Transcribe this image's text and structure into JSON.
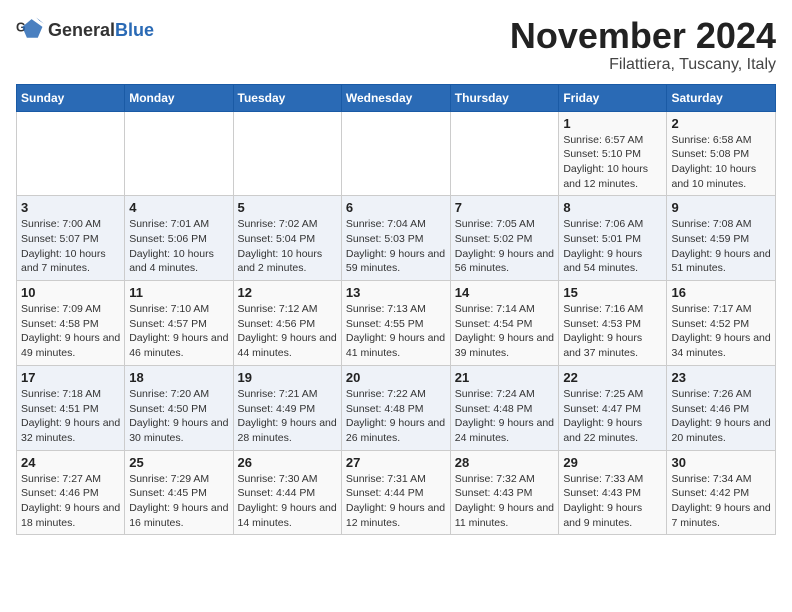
{
  "logo": {
    "general": "General",
    "blue": "Blue"
  },
  "header": {
    "month": "November 2024",
    "location": "Filattiera, Tuscany, Italy"
  },
  "weekdays": [
    "Sunday",
    "Monday",
    "Tuesday",
    "Wednesday",
    "Thursday",
    "Friday",
    "Saturday"
  ],
  "weeks": [
    [
      {
        "day": "",
        "info": ""
      },
      {
        "day": "",
        "info": ""
      },
      {
        "day": "",
        "info": ""
      },
      {
        "day": "",
        "info": ""
      },
      {
        "day": "",
        "info": ""
      },
      {
        "day": "1",
        "info": "Sunrise: 6:57 AM\nSunset: 5:10 PM\nDaylight: 10 hours and 12 minutes."
      },
      {
        "day": "2",
        "info": "Sunrise: 6:58 AM\nSunset: 5:08 PM\nDaylight: 10 hours and 10 minutes."
      }
    ],
    [
      {
        "day": "3",
        "info": "Sunrise: 7:00 AM\nSunset: 5:07 PM\nDaylight: 10 hours and 7 minutes."
      },
      {
        "day": "4",
        "info": "Sunrise: 7:01 AM\nSunset: 5:06 PM\nDaylight: 10 hours and 4 minutes."
      },
      {
        "day": "5",
        "info": "Sunrise: 7:02 AM\nSunset: 5:04 PM\nDaylight: 10 hours and 2 minutes."
      },
      {
        "day": "6",
        "info": "Sunrise: 7:04 AM\nSunset: 5:03 PM\nDaylight: 9 hours and 59 minutes."
      },
      {
        "day": "7",
        "info": "Sunrise: 7:05 AM\nSunset: 5:02 PM\nDaylight: 9 hours and 56 minutes."
      },
      {
        "day": "8",
        "info": "Sunrise: 7:06 AM\nSunset: 5:01 PM\nDaylight: 9 hours and 54 minutes."
      },
      {
        "day": "9",
        "info": "Sunrise: 7:08 AM\nSunset: 4:59 PM\nDaylight: 9 hours and 51 minutes."
      }
    ],
    [
      {
        "day": "10",
        "info": "Sunrise: 7:09 AM\nSunset: 4:58 PM\nDaylight: 9 hours and 49 minutes."
      },
      {
        "day": "11",
        "info": "Sunrise: 7:10 AM\nSunset: 4:57 PM\nDaylight: 9 hours and 46 minutes."
      },
      {
        "day": "12",
        "info": "Sunrise: 7:12 AM\nSunset: 4:56 PM\nDaylight: 9 hours and 44 minutes."
      },
      {
        "day": "13",
        "info": "Sunrise: 7:13 AM\nSunset: 4:55 PM\nDaylight: 9 hours and 41 minutes."
      },
      {
        "day": "14",
        "info": "Sunrise: 7:14 AM\nSunset: 4:54 PM\nDaylight: 9 hours and 39 minutes."
      },
      {
        "day": "15",
        "info": "Sunrise: 7:16 AM\nSunset: 4:53 PM\nDaylight: 9 hours and 37 minutes."
      },
      {
        "day": "16",
        "info": "Sunrise: 7:17 AM\nSunset: 4:52 PM\nDaylight: 9 hours and 34 minutes."
      }
    ],
    [
      {
        "day": "17",
        "info": "Sunrise: 7:18 AM\nSunset: 4:51 PM\nDaylight: 9 hours and 32 minutes."
      },
      {
        "day": "18",
        "info": "Sunrise: 7:20 AM\nSunset: 4:50 PM\nDaylight: 9 hours and 30 minutes."
      },
      {
        "day": "19",
        "info": "Sunrise: 7:21 AM\nSunset: 4:49 PM\nDaylight: 9 hours and 28 minutes."
      },
      {
        "day": "20",
        "info": "Sunrise: 7:22 AM\nSunset: 4:48 PM\nDaylight: 9 hours and 26 minutes."
      },
      {
        "day": "21",
        "info": "Sunrise: 7:24 AM\nSunset: 4:48 PM\nDaylight: 9 hours and 24 minutes."
      },
      {
        "day": "22",
        "info": "Sunrise: 7:25 AM\nSunset: 4:47 PM\nDaylight: 9 hours and 22 minutes."
      },
      {
        "day": "23",
        "info": "Sunrise: 7:26 AM\nSunset: 4:46 PM\nDaylight: 9 hours and 20 minutes."
      }
    ],
    [
      {
        "day": "24",
        "info": "Sunrise: 7:27 AM\nSunset: 4:46 PM\nDaylight: 9 hours and 18 minutes."
      },
      {
        "day": "25",
        "info": "Sunrise: 7:29 AM\nSunset: 4:45 PM\nDaylight: 9 hours and 16 minutes."
      },
      {
        "day": "26",
        "info": "Sunrise: 7:30 AM\nSunset: 4:44 PM\nDaylight: 9 hours and 14 minutes."
      },
      {
        "day": "27",
        "info": "Sunrise: 7:31 AM\nSunset: 4:44 PM\nDaylight: 9 hours and 12 minutes."
      },
      {
        "day": "28",
        "info": "Sunrise: 7:32 AM\nSunset: 4:43 PM\nDaylight: 9 hours and 11 minutes."
      },
      {
        "day": "29",
        "info": "Sunrise: 7:33 AM\nSunset: 4:43 PM\nDaylight: 9 hours and 9 minutes."
      },
      {
        "day": "30",
        "info": "Sunrise: 7:34 AM\nSunset: 4:42 PM\nDaylight: 9 hours and 7 minutes."
      }
    ]
  ]
}
